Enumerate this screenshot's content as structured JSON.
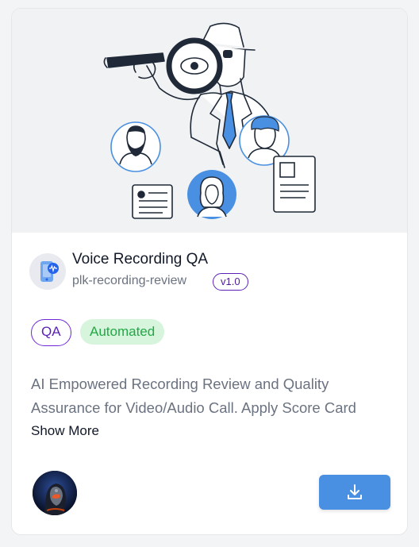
{
  "app": {
    "title": "Voice Recording QA",
    "slug": "plk-recording-review",
    "version": "v1.0",
    "icon": "phone-audio-icon"
  },
  "tags": [
    {
      "label": "QA",
      "color": "#5b21b6"
    },
    {
      "label": "Automated",
      "color": "#22a846",
      "bg": "#d7f5dc"
    }
  ],
  "description": {
    "line1": "AI Empowered Recording Review and Quality",
    "line2": "Assurance for Video/Audio Call. Apply Score Card",
    "show_more": "Show More"
  },
  "footer": {
    "avatar": "robot-avatar",
    "download_icon": "download-icon",
    "accent": "#4a90e2"
  }
}
